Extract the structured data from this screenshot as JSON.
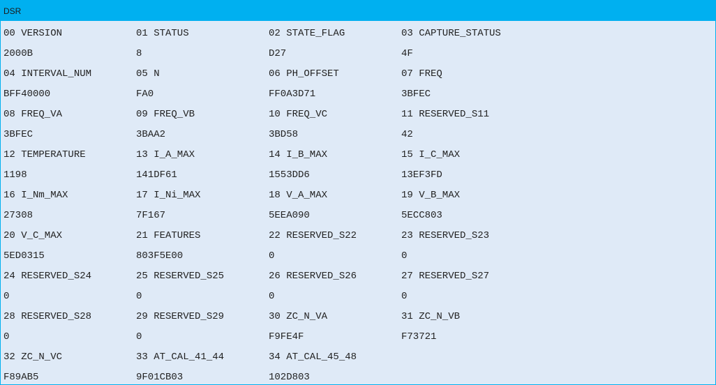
{
  "title": "DSR",
  "registers": [
    {
      "name": "00 VERSION",
      "value": "2000B"
    },
    {
      "name": "01 STATUS",
      "value": "8"
    },
    {
      "name": "02 STATE_FLAG",
      "value": "D27"
    },
    {
      "name": "03 CAPTURE_STATUS",
      "value": "4F"
    },
    {
      "name": "04 INTERVAL_NUM",
      "value": "BFF40000"
    },
    {
      "name": "05 N",
      "value": "FA0"
    },
    {
      "name": "06 PH_OFFSET",
      "value": "FF0A3D71"
    },
    {
      "name": "07 FREQ",
      "value": "3BFEC"
    },
    {
      "name": "08 FREQ_VA",
      "value": "3BFEC"
    },
    {
      "name": "09 FREQ_VB",
      "value": "3BAA2"
    },
    {
      "name": "10 FREQ_VC",
      "value": "3BD58"
    },
    {
      "name": "11 RESERVED_S11",
      "value": "42"
    },
    {
      "name": "12 TEMPERATURE",
      "value": "1198"
    },
    {
      "name": "13 I_A_MAX",
      "value": "141DF61"
    },
    {
      "name": "14 I_B_MAX",
      "value": "1553DD6"
    },
    {
      "name": "15 I_C_MAX",
      "value": "13EF3FD"
    },
    {
      "name": "16 I_Nm_MAX",
      "value": "27308"
    },
    {
      "name": "17 I_Ni_MAX",
      "value": "7F167"
    },
    {
      "name": "18 V_A_MAX",
      "value": "5EEA090"
    },
    {
      "name": "19 V_B_MAX",
      "value": "5ECC803"
    },
    {
      "name": "20 V_C_MAX",
      "value": "5ED0315"
    },
    {
      "name": "21 FEATURES",
      "value": "803F5E00"
    },
    {
      "name": "22 RESERVED_S22",
      "value": "0"
    },
    {
      "name": "23 RESERVED_S23",
      "value": "0"
    },
    {
      "name": "24 RESERVED_S24",
      "value": "0"
    },
    {
      "name": "25 RESERVED_S25",
      "value": "0"
    },
    {
      "name": "26 RESERVED_S26",
      "value": "0"
    },
    {
      "name": "27 RESERVED_S27",
      "value": "0"
    },
    {
      "name": "28 RESERVED_S28",
      "value": "0"
    },
    {
      "name": "29 RESERVED_S29",
      "value": "0"
    },
    {
      "name": "30 ZC_N_VA",
      "value": "F9FE4F"
    },
    {
      "name": "31 ZC_N_VB",
      "value": "F73721"
    },
    {
      "name": "32 ZC_N_VC",
      "value": "F89AB5"
    },
    {
      "name": "33 AT_CAL_41_44",
      "value": "9F01CB03"
    },
    {
      "name": "34 AT_CAL_45_48",
      "value": "102D803"
    }
  ]
}
